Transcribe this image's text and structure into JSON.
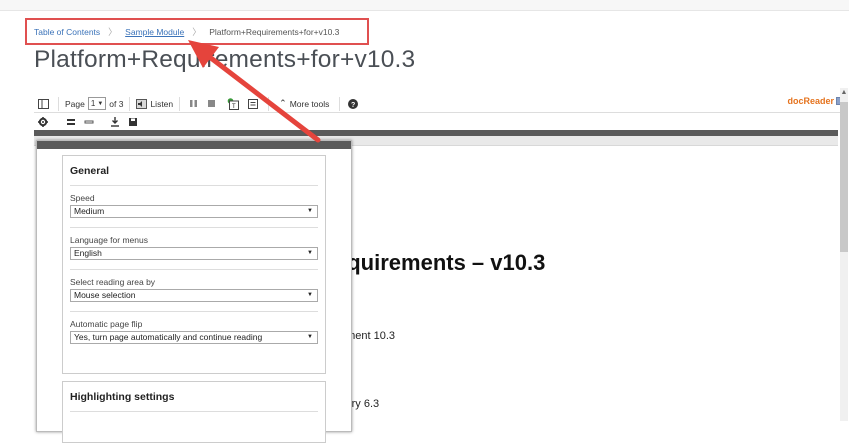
{
  "breadcrumb": {
    "items": [
      "Table of Contents",
      "Sample Module",
      "Platform+Requirements+for+v10.3"
    ],
    "separator": "〉"
  },
  "page_title": "Platform+Requirements+for+v10.3",
  "toolbar": {
    "page_label": "Page",
    "page_value": "1",
    "of_label": "of 3",
    "listen_label": "Listen",
    "more_tools_label": "More tools",
    "brand_label": "docReader"
  },
  "document": {
    "heading": "equirements – v10.3",
    "lines": [
      "nment 10.3",
      "itory 6.3"
    ]
  },
  "settings": {
    "general_title": "General",
    "fields": [
      {
        "label": "Speed",
        "value": "Medium"
      },
      {
        "label": "Language for menus",
        "value": "English"
      },
      {
        "label": "Select reading area by",
        "value": "Mouse selection"
      },
      {
        "label": "Automatic page flip",
        "value": "Yes, turn page automatically and continue reading"
      }
    ],
    "highlighting_title": "Highlighting settings"
  },
  "colors": {
    "accent_red": "#e05050",
    "link_blue": "#3b73b9",
    "brand_orange": "#e5731e"
  }
}
